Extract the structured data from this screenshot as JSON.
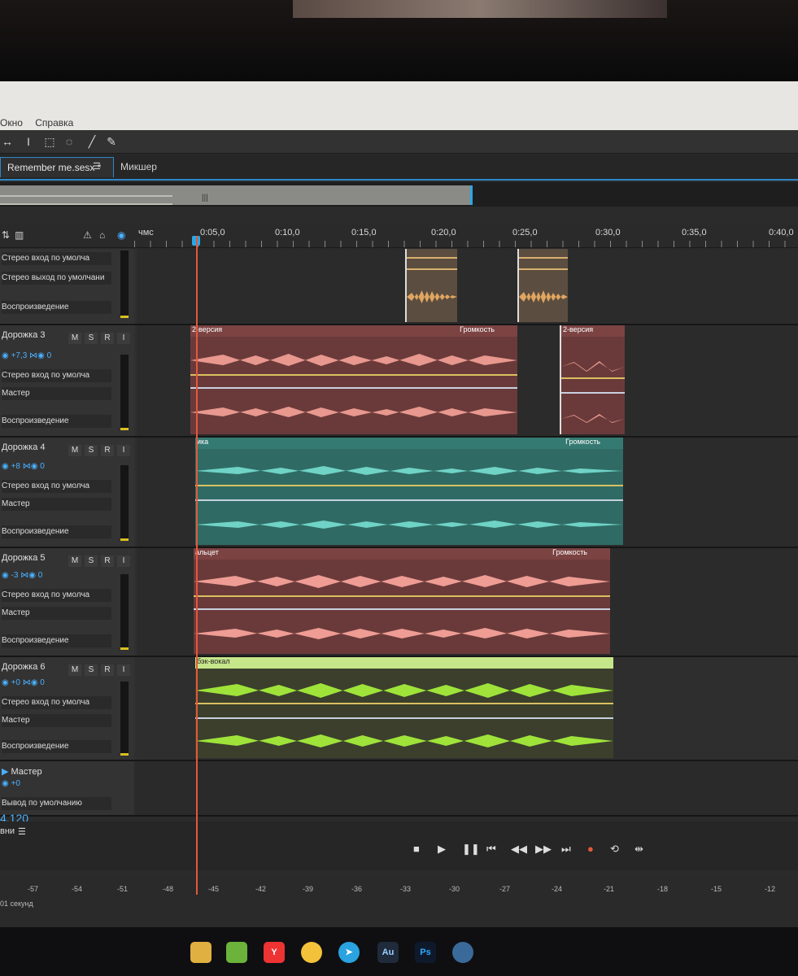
{
  "menu": [
    "Окно",
    "Справка"
  ],
  "tabs": {
    "editor": "Remember me.sesx *",
    "mixer": "Микшер"
  },
  "ruler": {
    "unit": "чмс",
    "ticks": [
      "0:05,0",
      "0:10,0",
      "0:15,0",
      "0:20,0",
      "0:25,0",
      "0:30,0",
      "0:35,0",
      "0:40,0"
    ]
  },
  "tracks": [
    {
      "name": "",
      "input": "Стерео вход по умолча",
      "output": "Стерео выход по умолчани",
      "mode": "Воспроизведение",
      "color": "#e0a560",
      "clips": [
        {
          "title": ""
        },
        {
          "title": ""
        }
      ]
    },
    {
      "name": "Дорожка 3",
      "vol": "+7,3",
      "pan": "0",
      "input": "Стерео вход по умолча",
      "output": "Мастер",
      "mode": "Воспроизведение",
      "color": "#e8988e",
      "clips": [
        {
          "title": "2-версия",
          "vol": "Громкость"
        },
        {
          "title": "2-версия"
        }
      ]
    },
    {
      "name": "Дорожка 4",
      "vol": "+8",
      "pan": "0",
      "input": "Стерео вход по умолча",
      "output": "Мастер",
      "mode": "Воспроизведение",
      "color": "#6fd3c6",
      "clips": [
        {
          "title": "ика",
          "vol": "Громкость"
        }
      ]
    },
    {
      "name": "Дорожка 5",
      "vol": "-3",
      "pan": "0",
      "input": "Стерео вход по умолча",
      "output": "Мастер",
      "mode": "Воспроизведение",
      "color": "#ee9c94",
      "clips": [
        {
          "title": "альцет",
          "vol": "Громкость"
        }
      ]
    },
    {
      "name": "Дорожка 6",
      "vol": "+0",
      "pan": "0",
      "input": "Стерео вход по умолча",
      "output": "Мастер",
      "mode": "Воспроизведение",
      "color": "#9fe33a",
      "clips": [
        {
          "title": "бэк-вокал"
        }
      ]
    }
  ],
  "master": {
    "name": "Мастер",
    "vol": "+0",
    "output": "Вывод по умолчанию"
  },
  "timecode": "4.120",
  "levels": {
    "label": "вни",
    "unit": "01 секунд",
    "scale": [
      "-57",
      "-54",
      "-51",
      "-48",
      "-45",
      "-42",
      "-39",
      "-36",
      "-33",
      "-30",
      "-27",
      "-24",
      "-21",
      "-18",
      "-15",
      "-12"
    ]
  },
  "taskbar": [
    "explorer",
    "utorrent",
    "yandex",
    "chrome",
    "telegram",
    "Au",
    "Ps",
    "other"
  ]
}
